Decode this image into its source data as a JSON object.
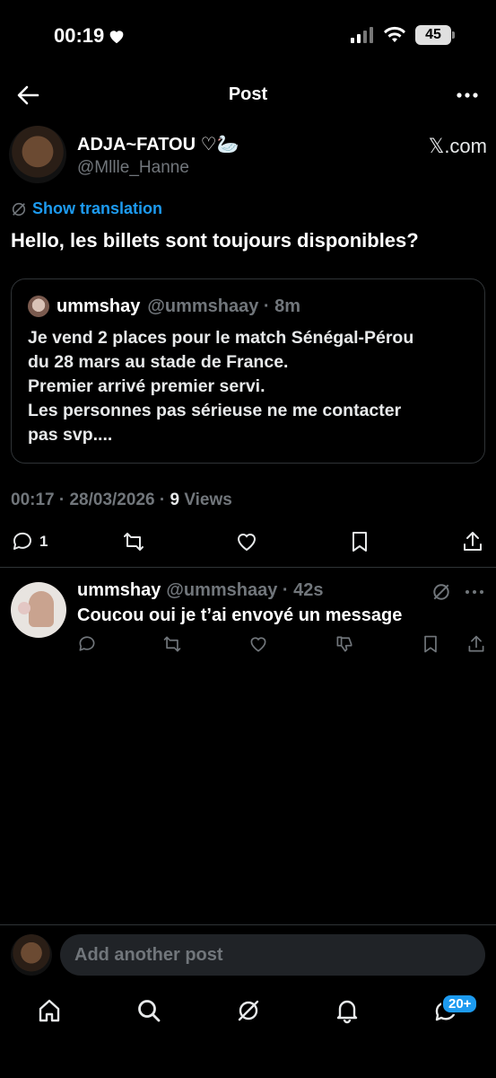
{
  "status_bar": {
    "time": "00:19",
    "battery": "45"
  },
  "topbar": {
    "title": "Post"
  },
  "post": {
    "author_name": "ADJA~FATOU ♡🦢",
    "author_handle": "@Mllle_Hanne",
    "source_link": "𝕏.com",
    "translate_label": "Show translation",
    "text": "Hello, les billets sont toujours disponibles?",
    "quote": {
      "name": "ummshay",
      "handle_time": "@ummshaay · 8m",
      "lines": [
        "Je vend 2 places pour le match Sénégal-Pérou",
        "du 28 mars au stade de France.",
        "Premier arrivé premier servi.",
        "Les personnes pas sérieuse ne me contacter",
        "pas svp...."
      ]
    },
    "meta_time": "00:17 · 28/03/2026 · ",
    "views_count": "9",
    "views_label": " Views",
    "reply_count": "1"
  },
  "reply": {
    "name": "ummshay",
    "handle_time": "@ummshaay · 42s",
    "text": "Coucou oui je t’ai envoyé un message"
  },
  "compose": {
    "placeholder": "Add another post"
  },
  "bottom_nav": {
    "badge": "20+"
  },
  "colors": {
    "accent": "#1d9bf0",
    "muted": "#71767b",
    "divider": "#2f3336"
  }
}
